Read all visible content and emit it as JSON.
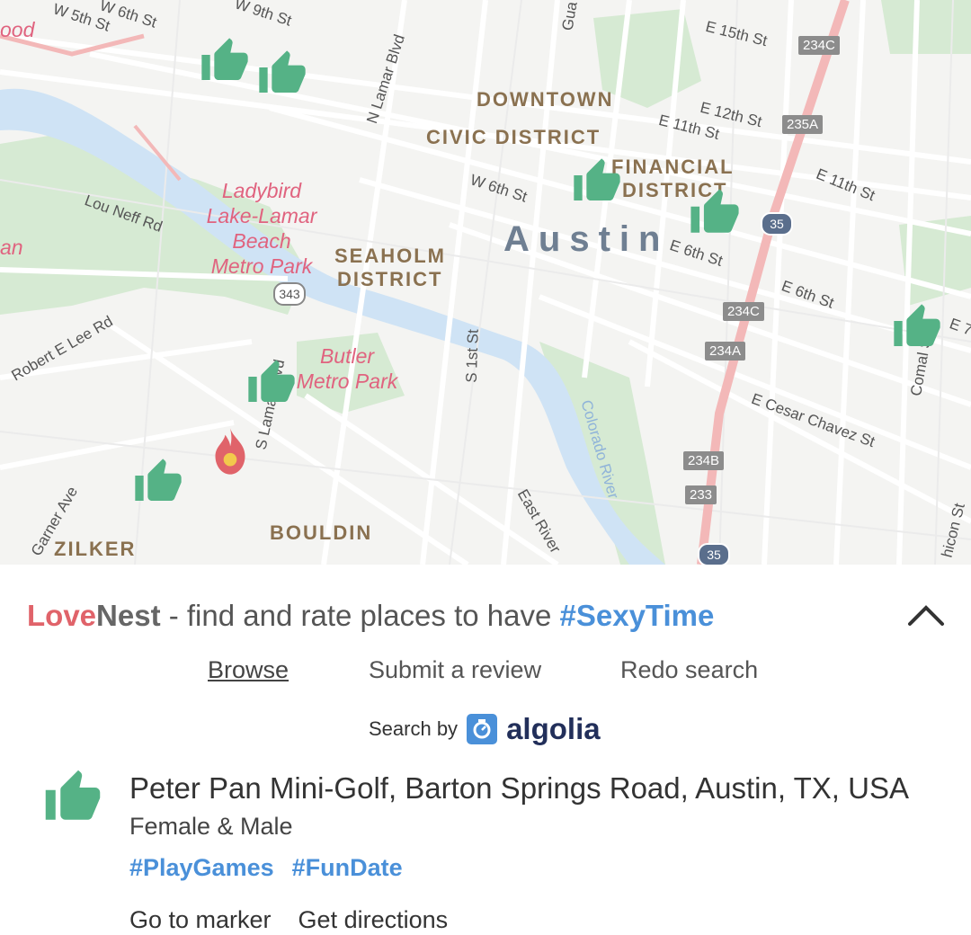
{
  "map": {
    "city_label": "Austin",
    "districts": [
      "DOWNTOWN",
      "CIVIC DISTRICT",
      "FINANCIAL",
      "DISTRICT",
      "SEAHOLM",
      "DISTRICT",
      "BOULDIN",
      "ZILKER"
    ],
    "parks": [
      "Ladybird",
      "Lake-Lamar",
      "Beach",
      "Metro Park",
      "Butler",
      "Metro Park"
    ],
    "streets": [
      "W 6th St",
      "W 5th St",
      "W 9th St",
      "N Lamar Blvd",
      "E 15th St",
      "E 12th St",
      "E 11th St",
      "E 11th St",
      "W 6th St",
      "E 6th St",
      "E 6th St",
      "Lou Neff Rd",
      "Robert E Lee Rd",
      "S 1st St",
      "Colorado River",
      "E Cesar Chavez St",
      "Comal St",
      "Garner Ave",
      "East River",
      "S Lamar Blvd",
      "Gua",
      "an",
      "ood",
      "E 7",
      "hicon St"
    ],
    "exit_shields": [
      "234C",
      "235A",
      "234C",
      "234A",
      "234B",
      "233"
    ],
    "highway_shields": [
      "343",
      "35",
      "35"
    ]
  },
  "app": {
    "brand_love": "Love",
    "brand_nest": "Nest",
    "tagline": " - find and rate places to have ",
    "hashtag": "#SexyTime",
    "collapse_icon": "chevron-up-icon"
  },
  "nav": {
    "browse": "Browse",
    "submit": "Submit a review",
    "redo": "Redo search"
  },
  "search_by": {
    "label": "Search by",
    "provider": "algolia"
  },
  "result": {
    "icon": "thumbs-up-icon",
    "title": "Peter Pan Mini-Golf, Barton Springs Road, Austin, TX, USA",
    "subtitle": "Female & Male",
    "tags": [
      "#PlayGames",
      "#FunDate"
    ],
    "actions": [
      "Go to marker",
      "Get directions"
    ]
  },
  "colors": {
    "thumb": "#55b286",
    "flame": "#e0636a",
    "brand_love": "#e0636a",
    "link": "#4a90d9"
  }
}
